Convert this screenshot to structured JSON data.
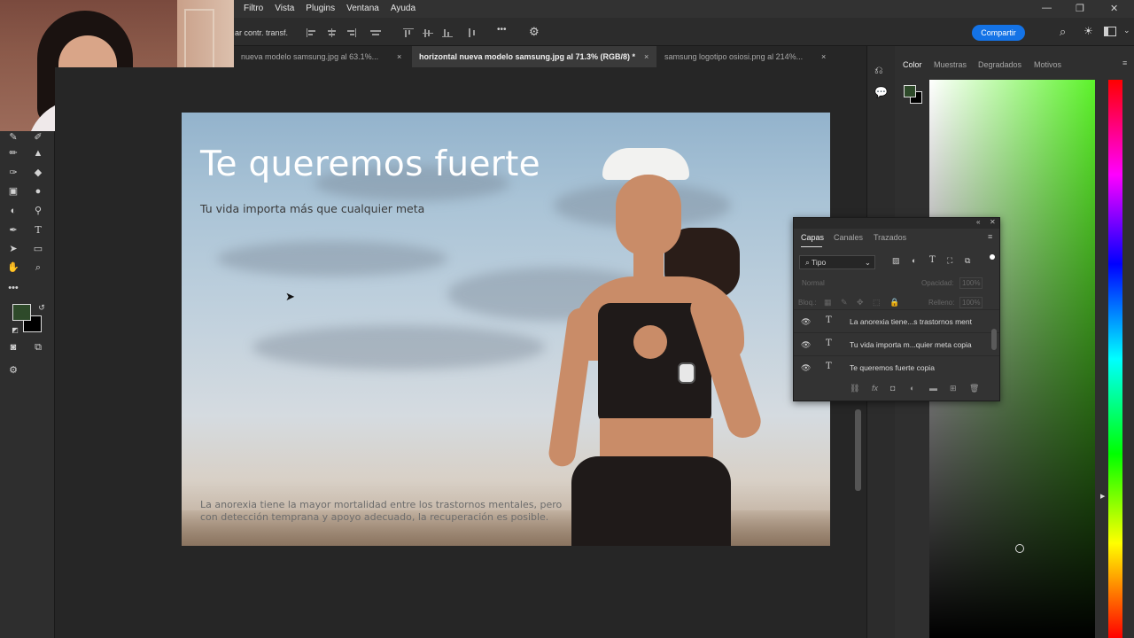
{
  "menu": {
    "items": [
      "Filtro",
      "Vista",
      "Plugins",
      "Ventana",
      "Ayuda"
    ]
  },
  "options_bar": {
    "transform_label": "ar contr. transf.",
    "share_label": "Compartir",
    "more_label": "•••"
  },
  "tabs": [
    {
      "label": "nueva modelo samsung.jpg al 63.1%...",
      "close": "×"
    },
    {
      "label": "horizontal nueva modelo samsung.jpg al 71.3% (RGB/8) *",
      "close": "×"
    },
    {
      "label": "samsung logotipo osiosi.png al 214%...",
      "close": "×"
    }
  ],
  "artboard": {
    "headline": "Te queremos fuerte",
    "subhead": "Tu vida importa más que cualquier meta",
    "body": "La anorexia tiene la mayor mortalidad entre los trastornos mentales, pero con detección temprana y apoyo adecuado, la recuperación es posible."
  },
  "color_panel": {
    "tabs": [
      "Color",
      "Muestras",
      "Degradados",
      "Motivos"
    ]
  },
  "layers_panel": {
    "tabs": [
      "Capas",
      "Canales",
      "Trazados"
    ],
    "filter_label": "Tipo",
    "blend_mode": "Normal",
    "opacity_label": "Opacidad:",
    "opacity_value": "100%",
    "lock_label": "Bloq.:",
    "fill_label": "Relleno:",
    "fill_value": "100%",
    "layers": [
      {
        "name": "La anorexia tiene...s trastornos ment"
      },
      {
        "name": "Tu vida importa m...quier meta copia"
      },
      {
        "name": "Te queremos fuerte copia"
      }
    ],
    "footer_fx": "fx"
  },
  "colors": {
    "accent": "#1473e6",
    "foreground_swatch": "#2e4a2a",
    "background_swatch": "#000000"
  }
}
